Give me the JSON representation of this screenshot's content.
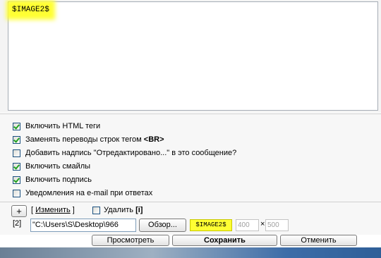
{
  "editor": {
    "highlight_text": "$IMAGE2$"
  },
  "options": [
    {
      "label": "Включить HTML теги",
      "bold": "",
      "checked": true
    },
    {
      "label": "Заменять переводы строк тегом ",
      "bold": "<BR>",
      "checked": true
    },
    {
      "label": "Добавить надпись \"Отредактировано...\" в это сообщение?",
      "bold": "",
      "checked": false
    },
    {
      "label": "Включить смайлы",
      "bold": "",
      "checked": true
    },
    {
      "label": "Включить подпись",
      "bold": "",
      "checked": true
    },
    {
      "label": "Уведомления на e-mail при ответах",
      "bold": "",
      "checked": false
    }
  ],
  "attach": {
    "plus_label": "+",
    "link_prefix": "[ ",
    "change_link": "Изменить",
    "link_suffix": " ]",
    "delete_label": "Удалить ",
    "info_label": "[i]",
    "index_label": "[2]",
    "file_path": "\"C:\\Users\\S\\Desktop\\966",
    "browse_label": "Обзор...",
    "tag_label": "$IMAGE2$",
    "width_value": "400",
    "times": "×",
    "height_value": "500"
  },
  "actions": {
    "preview_label": "Просмотреть",
    "save_label": "Сохранить",
    "cancel_label": "Отменить"
  },
  "colors": {
    "highlight": "#ffff33",
    "check": "#21a121"
  }
}
